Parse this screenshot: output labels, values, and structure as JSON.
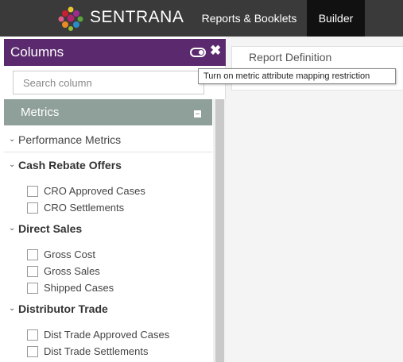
{
  "brand": {
    "name": "SENTRANA"
  },
  "nav": {
    "reports": "Reports & Booklets",
    "builder": "Builder"
  },
  "panel": {
    "title": "Columns",
    "search_placeholder": "Search column",
    "section": "Metrics",
    "subsection": "Performance Metrics",
    "groups": [
      {
        "label": "Cash Rebate Offers",
        "items": [
          "CRO Approved Cases",
          "CRO Settlements"
        ]
      },
      {
        "label": "Direct Sales",
        "items": [
          "Gross Cost",
          "Gross Sales",
          "Shipped Cases"
        ]
      },
      {
        "label": "Distributor Trade",
        "items": [
          "Dist Trade Approved Cases",
          "Dist Trade Settlements"
        ]
      }
    ]
  },
  "report": {
    "title": "Report Definition"
  },
  "tooltip": {
    "text": "Turn on metric attribute mapping restriction"
  },
  "colors": {
    "topbar": "#3a3a3a",
    "active_nav": "#111111",
    "panel_header": "#5b2a6e",
    "metrics_bar": "#8fa09a"
  },
  "icons": [
    "sentrana-logo",
    "toggle-icon",
    "close-icon",
    "collapse-icon",
    "chevron-down-icon",
    "checkbox"
  ]
}
